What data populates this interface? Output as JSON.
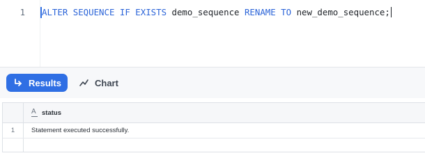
{
  "editor": {
    "line_number": "1",
    "tokens": {
      "kw1": "ALTER SEQUENCE IF EXISTS",
      "name1": "demo_sequence",
      "kw2": "RENAME TO",
      "name2": "new_demo_sequence;"
    }
  },
  "tabs": {
    "results_label": "Results",
    "chart_label": "Chart"
  },
  "grid": {
    "columns": [
      {
        "type_icon": "A",
        "name": "status"
      }
    ],
    "rows": [
      {
        "index": "1",
        "cells": [
          "Statement executed successfully."
        ]
      }
    ]
  },
  "colors": {
    "accent": "#2f6fe4",
    "keyword": "#2a63d8"
  }
}
